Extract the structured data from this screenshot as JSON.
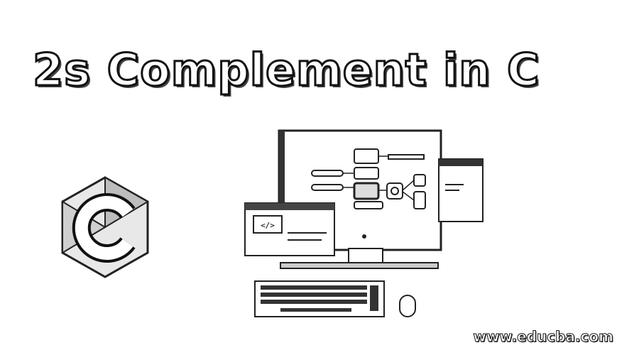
{
  "title": "2s Complement in C",
  "logo": {
    "icon": "c-language-logo-icon",
    "letter": "C"
  },
  "illustration": {
    "icon": "desktop-computer-code-icon"
  },
  "watermark": "www.educba.com"
}
